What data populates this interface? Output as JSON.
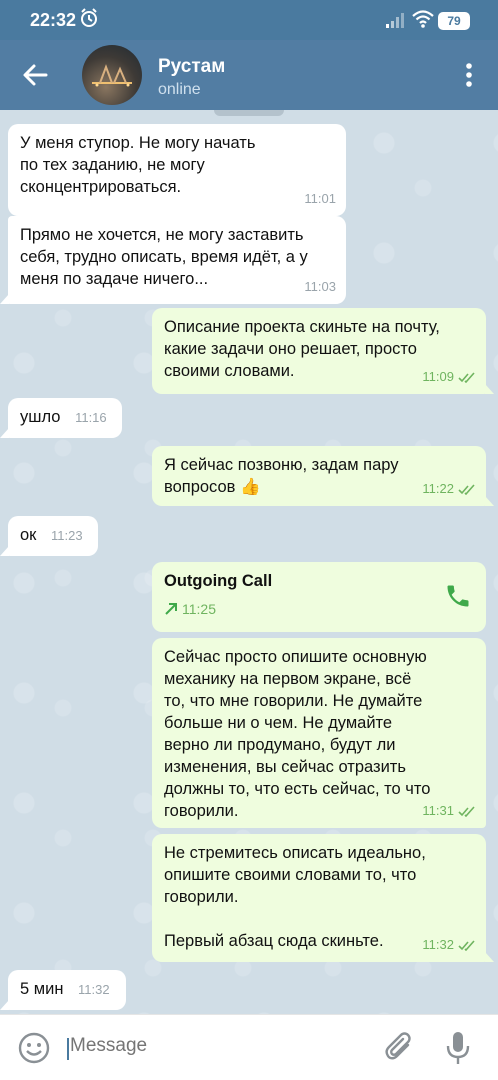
{
  "status_bar": {
    "time": "22:32",
    "battery": "79"
  },
  "header": {
    "name": "Рустам",
    "status": "online"
  },
  "input": {
    "placeholder": "Message"
  },
  "messages": [
    {
      "dir": "in",
      "text": "У меня ступор. Не могу начать\nпо тех заданию, не могу\nсконцентрироваться.",
      "time": "11:01"
    },
    {
      "dir": "in",
      "text": "Прямо не хочется, не могу заставить\nсебя, трудно описать, время идёт, а у\nменя по задаче ничего...",
      "time": "11:03"
    },
    {
      "dir": "out",
      "text": "Описание проекта скиньте на почту,\nкакие задачи оно решает, просто\nсвоими словами.",
      "time": "11:09"
    },
    {
      "dir": "in",
      "text": "ушло",
      "time": "11:16"
    },
    {
      "dir": "out",
      "text": "Я сейчас позвоню, задам пару\nвопросов 👍",
      "time": "11:22"
    },
    {
      "dir": "in",
      "text": "ок",
      "time": "11:23"
    },
    {
      "dir": "out",
      "type": "call",
      "title": "Outgoing Call",
      "time": "11:25"
    },
    {
      "dir": "out",
      "text": "Сейчас просто опишите основную\nмеханику на первом экране, всё\nто, что мне говорили. Не думайте\nбольше ни о чем. Не думайте\nверно ли продумано, будут ли\nизменения, вы сейчас отразить\nдолжны то, что есть сейчас, то что\nговорили.",
      "time": "11:31"
    },
    {
      "dir": "out",
      "text": "Не стремитесь описать идеально,\nопишите своими словами то, что\nговорили.\n\nПервый абзац сюда скиньте.",
      "time": "11:32"
    },
    {
      "dir": "in",
      "text": "5 мин",
      "time": "11:32"
    }
  ]
}
